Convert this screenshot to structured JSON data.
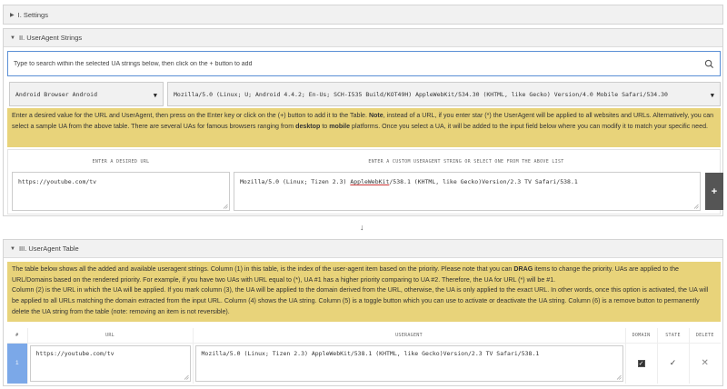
{
  "settings": {
    "title": "I. Settings"
  },
  "ua_strings": {
    "title": "II. UserAgent Strings",
    "search_placeholder": "Type to search within the selected UA strings below, then click on the + button to add",
    "browser_select": "Android Browser Android",
    "ua_select": "Mozilla/5.0 (Linux; U; Android 4.4.2; En-Us; SCH-I535 Build/KOT49H) AppleWebKit/534.30 (KHTML, like Gecko) Version/4.0 Mobile Safari/534.30",
    "note_part1": "Enter a desired value for the URL and UserAgent, then press on the Enter key or click on the (+) button to add it to the Table. ",
    "note_bold1": "Note",
    "note_part2": ", instead of a URL, if you enter star (*) the UserAgent will be applied to all websites and URLs. Alternatively, you can select a sample UA from the above table. There are several UAs for famous browsers ranging from ",
    "note_bold2": "desktop",
    "note_part3": " to ",
    "note_bold3": "mobile",
    "note_part4": " platforms. Once you select a UA, it will be added to the input field below where you can modify it to match your specific need.",
    "url_label": "ENTER A DESIRED URL",
    "ua_label": "ENTER A CUSTOM USERAGENT STRING OR SELECT ONE FROM THE ABOVE LIST",
    "url_value": "https://youtube.com/tv",
    "ua_value_pre": "Mozilla/5.0 (Linux; Tizen 2.3) ",
    "ua_value_underlined": "AppleWebKit",
    "ua_value_post": "/538.1 (KHTML, like Gecko)Version/2.3 TV Safari/538.1",
    "plus_label": "+"
  },
  "arrow": "↓",
  "ua_table": {
    "title": "III. UserAgent Table",
    "note_part1": "The table below shows all the added and available useragent strings. Column (1) in this table, is the index of the user-agent item based on the priority. Please note that you can ",
    "note_bold": "DRAG",
    "note_part2": " items to change the priority. UAs are applied to the URL/Domains based on the rendered priority. For example, if you have two UAs with URL equal to (*), UA #1 has a higher priority comparing to UA #2. Therefore, the UA for URL (*) will be #1.",
    "note_part3": "Column (2) is the URL in which the UA will be applied. If you mark column (3), the UA will be applied to the domain derived from the URL, otherwise, the UA is only applied to the exact URL. In other words, once this option is activated, the UA will be applied to all URLs matching the domain extracted from the input URL. Column (4) shows the UA string. Column (5) is a toggle button which you can use to activate or deactivate the UA string. Column (6) is a remove button to permanently delete the UA string from the table (note: removing an item is not reversible).",
    "columns": [
      "#",
      "URL",
      "USERAGENT",
      "DOMAIN",
      "STATE",
      "DELETE"
    ],
    "rows": [
      {
        "index": "1",
        "url": "https://youtube.com/tv",
        "useragent": "Mozilla/5.0 (Linux; Tizen 2.3) AppleWebKit/538.1 (KHTML, like Gecko)Version/2.3 TV Safari/538.1",
        "domain_checked": "✓",
        "state": "✓",
        "delete": "✕"
      }
    ]
  }
}
